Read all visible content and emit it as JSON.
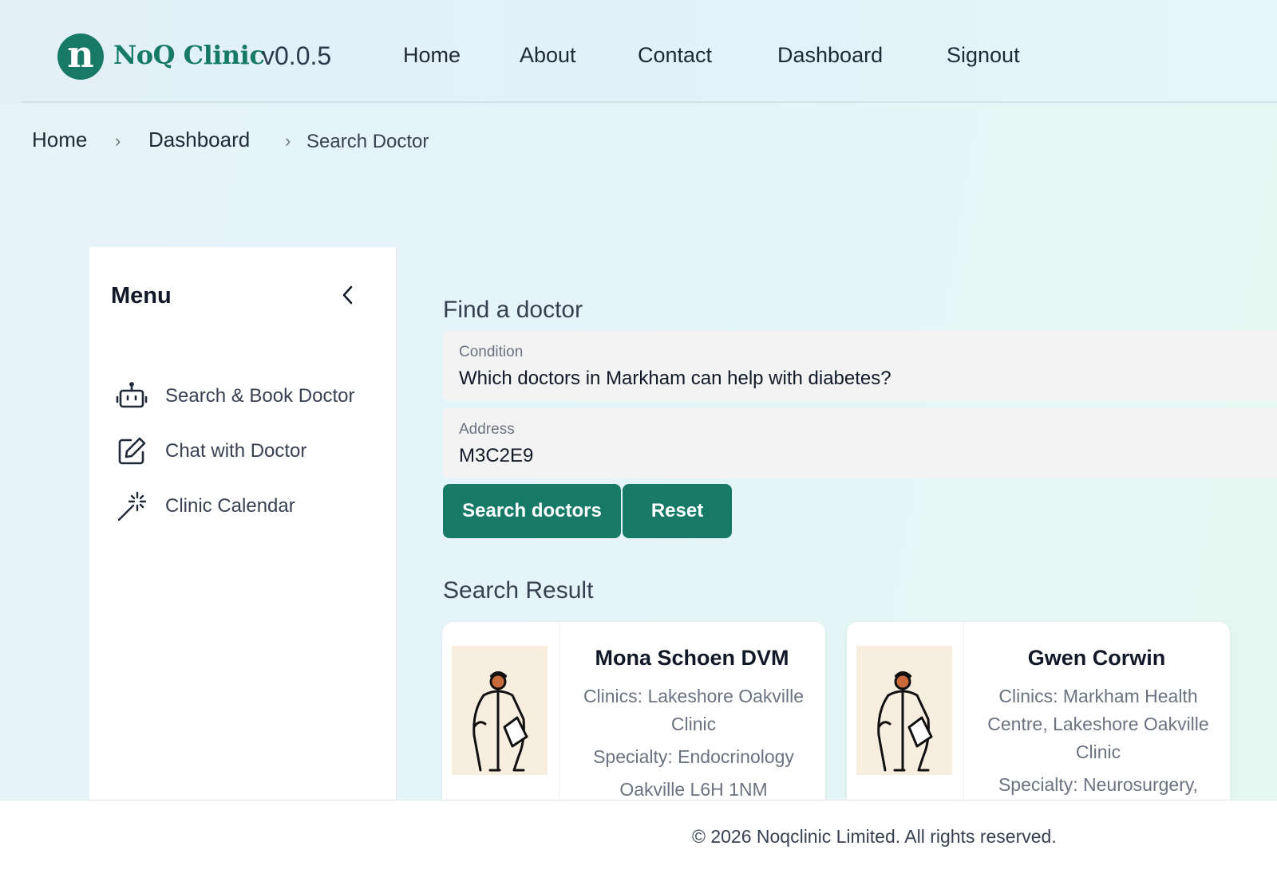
{
  "header": {
    "logo_letter": "n",
    "brand": "NoQ Clinic",
    "version": "v0.0.5",
    "nav": [
      "Home",
      "About",
      "Contact",
      "Dashboard",
      "Signout"
    ]
  },
  "breadcrumb": {
    "items": [
      "Home",
      "Dashboard"
    ],
    "current": "Search Doctor",
    "separator": "›"
  },
  "sidebar": {
    "title": "Menu",
    "collapse_icon": "chevron-left-icon",
    "items": [
      {
        "label": "Search & Book Doctor",
        "icon": "robot-icon"
      },
      {
        "label": "Chat with Doctor",
        "icon": "edit-icon"
      },
      {
        "label": "Clinic Calendar",
        "icon": "magic-wand-icon"
      }
    ]
  },
  "search": {
    "title": "Find a doctor",
    "condition": {
      "label": "Condition",
      "value": "Which doctors in Markham can help with diabetes?"
    },
    "address": {
      "label": "Address",
      "value": "M3C2E9"
    },
    "search_button": "Search doctors",
    "reset_button": "Reset"
  },
  "results": {
    "title": "Search Result",
    "cards": [
      {
        "name": "Mona Schoen DVM",
        "clinics": "Clinics: Lakeshore Oakville Clinic",
        "specialty": "Specialty: Endocrinology",
        "location": "Oakville L6H 1NM"
      },
      {
        "name": "Gwen Corwin",
        "clinics": "Clinics: Markham Health Centre, Lakeshore Oakville Clinic",
        "specialty": "Specialty: Neurosurgery,"
      }
    ]
  },
  "footer": {
    "copyright": "© 2026 Noqclinic Limited. All rights reserved."
  },
  "colors": {
    "brand": "#167a67",
    "button_text": "#ffffff",
    "muted_text": "#6b7280"
  }
}
